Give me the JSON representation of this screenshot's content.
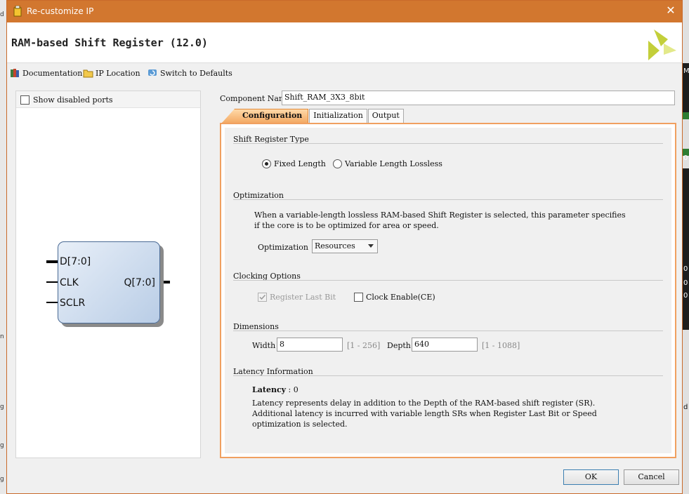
{
  "window": {
    "title": "Re-customize IP",
    "close_glyph": "✕"
  },
  "header": {
    "title": "RAM-based Shift Register (12.0)",
    "logo": "xilinx-logo"
  },
  "toolbar": {
    "documentation": "Documentation",
    "ip_location": "IP Location",
    "switch_defaults": "Switch to Defaults"
  },
  "left_panel": {
    "show_disabled_ports": "Show disabled ports",
    "symbol": {
      "inputs": [
        "D[7:0]",
        "CLK",
        "SCLR"
      ],
      "outputs": [
        "Q[7:0]"
      ]
    }
  },
  "component": {
    "label": "Component Name",
    "value": "Shift_RAM_3X3_8bit"
  },
  "tabs": [
    "Configuration",
    "Initialization",
    "Output"
  ],
  "config": {
    "shift_register_type": {
      "heading": "Shift Register Type",
      "options": [
        "Fixed Length",
        "Variable Length Lossless"
      ],
      "selected": "Fixed Length"
    },
    "optimization": {
      "heading": "Optimization",
      "description_1": "When a variable-length lossless RAM-based Shift Register is selected, this parameter specifies",
      "description_2": "if the core is to be optimized for area or speed.",
      "label": "Optimization",
      "value": "Resources"
    },
    "clocking": {
      "heading": "Clocking Options",
      "register_last_bit": "Register Last Bit",
      "clock_enable": "Clock Enable(CE)"
    },
    "dimensions": {
      "heading": "Dimensions",
      "width_label": "Width",
      "width_value": "8",
      "width_range": "[1 - 256]",
      "depth_label": "Depth",
      "depth_value": "640",
      "depth_range": "[1 - 1088]"
    },
    "latency": {
      "heading": "Latency Information",
      "label": "Latency",
      "separator": ":",
      "value": "0",
      "desc_1": "Latency represents delay in addition to the Depth of the RAM-based shift register (SR).",
      "desc_2": "Additional latency is incurred with variable length SRs when Register Last Bit or Speed",
      "desc_3": "optimization is selected."
    }
  },
  "buttons": {
    "ok": "OK",
    "cancel": "Cancel"
  },
  "background": {
    "left_chars": [
      "d",
      "n",
      "g",
      "g",
      "g"
    ],
    "right_chars": [
      "M",
      "0",
      "0",
      "0",
      "0",
      "d"
    ]
  }
}
